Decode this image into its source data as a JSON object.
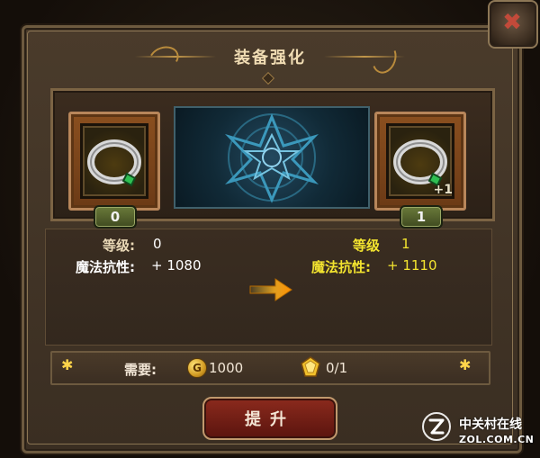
{
  "window": {
    "title": "装备强化"
  },
  "slots": {
    "left": {
      "item_icon": "ring-icon",
      "level_badge": "0"
    },
    "right": {
      "item_icon": "ring-icon",
      "plus": "+1",
      "level_badge": "1"
    }
  },
  "stats": {
    "current": {
      "level_label": "等级:",
      "level_value": "0",
      "attr_label": "魔法抗性:",
      "attr_value": "+ 1080"
    },
    "next": {
      "level_label": "等级",
      "level_value": "1",
      "attr_label": "魔法抗性:",
      "attr_value": "+ 1110"
    }
  },
  "requirements": {
    "label": "需要:",
    "gold_amount": "1000",
    "material_count": "0/1",
    "gold_icon": "gold-coin-icon",
    "material_icon": "enhancement-stone-icon"
  },
  "actions": {
    "upgrade_label": "提升",
    "close_icon": "close-icon"
  },
  "watermark": {
    "brand_cn": "中关村在线",
    "brand_en": "ZOL.COM.CN"
  },
  "colors": {
    "accent_gold": "#c2974a",
    "stat_yellow": "#f3e42f",
    "button_red": "#8b2a1d",
    "badge_green": "#6a7a3a",
    "magic_blue": "#23485e"
  }
}
